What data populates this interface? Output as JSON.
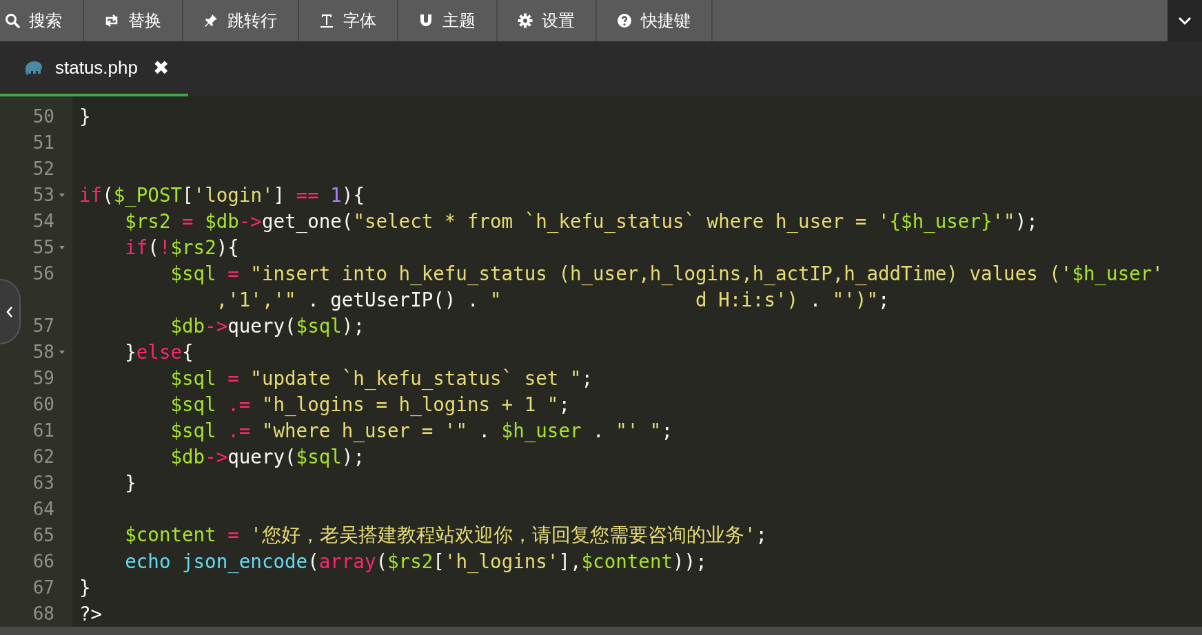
{
  "toolbar": {
    "items": [
      {
        "label": "搜索"
      },
      {
        "label": "替换"
      },
      {
        "label": "跳转行"
      },
      {
        "label": "字体"
      },
      {
        "label": "主题"
      },
      {
        "label": "设置"
      },
      {
        "label": "快捷键"
      }
    ]
  },
  "tabs": [
    {
      "label": "status.php",
      "selected": true,
      "close": "✖"
    }
  ],
  "editor": {
    "lines": [
      {
        "n": "50",
        "foldable": false,
        "tokens": [
          {
            "kind": "plain",
            "text": "}"
          }
        ]
      },
      {
        "n": "51",
        "foldable": false
      },
      {
        "n": "52",
        "foldable": false
      },
      {
        "n": "53",
        "foldable": true,
        "tokens": [
          {
            "kind": "keyword",
            "text": "if"
          },
          {
            "kind": "plain",
            "text": "("
          },
          {
            "kind": "variable",
            "text": "$_POST"
          },
          {
            "kind": "plain",
            "text": "["
          },
          {
            "kind": "string",
            "text": "'login'"
          },
          {
            "kind": "plain",
            "text": "]"
          },
          {
            "kind": "operator",
            "text": " == "
          },
          {
            "kind": "number",
            "text": "1"
          },
          {
            "kind": "plain",
            "text": "){"
          }
        ]
      },
      {
        "n": "54",
        "foldable": false,
        "tokens": [
          {
            "kind": "variable",
            "text": "    $rs2"
          },
          {
            "kind": "operator",
            "text": " = "
          },
          {
            "kind": "variable",
            "text": "$db"
          },
          {
            "kind": "operator",
            "text": "->"
          },
          {
            "kind": "plain",
            "text": "get_one("
          },
          {
            "kind": "string",
            "text": "\"select * from `h_kefu_status` where h_user = '"
          },
          {
            "kind": "variable",
            "text": "{$h_user}"
          },
          {
            "kind": "string",
            "text": "'\""
          },
          {
            "kind": "plain",
            "text": ");"
          }
        ]
      },
      {
        "n": "55",
        "foldable": true,
        "tokens": [
          {
            "kind": "keyword",
            "text": "    if"
          },
          {
            "kind": "plain",
            "text": "("
          },
          {
            "kind": "operator",
            "text": "!"
          },
          {
            "kind": "variable",
            "text": "$rs2"
          },
          {
            "kind": "plain",
            "text": "){"
          }
        ]
      },
      {
        "n": "56",
        "foldable": false,
        "tokens": [
          {
            "kind": "variable",
            "text": "        $sql"
          },
          {
            "kind": "operator",
            "text": " = "
          },
          {
            "kind": "string",
            "text": "\"insert into h_kefu_status (h_user,h_logins,h_actIP,h_addTime) values ('"
          },
          {
            "kind": "variable",
            "text": "$h_user"
          },
          {
            "kind": "string",
            "text": "'"
          }
        ],
        "wrap": [
          {
            "kind": "string",
            "text": "            ,'1','\""
          },
          {
            "kind": "plain",
            "text": " . getUserIP() . "
          },
          {
            "kind": "string",
            "text": "\""
          },
          {
            "kind": "gap"
          },
          {
            "kind": "string",
            "text": "d H:i:s')"
          },
          {
            "kind": "plain",
            "text": " . "
          },
          {
            "kind": "string",
            "text": "\"')\""
          },
          {
            "kind": "plain",
            "text": ";"
          }
        ]
      },
      {
        "n": "57",
        "foldable": false,
        "tokens": [
          {
            "kind": "variable",
            "text": "        $db"
          },
          {
            "kind": "operator",
            "text": "->"
          },
          {
            "kind": "plain",
            "text": "query("
          },
          {
            "kind": "variable",
            "text": "$sql"
          },
          {
            "kind": "plain",
            "text": ");"
          }
        ]
      },
      {
        "n": "58",
        "foldable": true,
        "tokens": [
          {
            "kind": "plain",
            "text": "    }"
          },
          {
            "kind": "keyword",
            "text": "else"
          },
          {
            "kind": "plain",
            "text": "{"
          }
        ]
      },
      {
        "n": "59",
        "foldable": false,
        "tokens": [
          {
            "kind": "variable",
            "text": "        $sql"
          },
          {
            "kind": "operator",
            "text": " = "
          },
          {
            "kind": "string",
            "text": "\"update `h_kefu_status` set \""
          },
          {
            "kind": "plain",
            "text": ";"
          }
        ]
      },
      {
        "n": "60",
        "foldable": false,
        "tokens": [
          {
            "kind": "variable",
            "text": "        $sql"
          },
          {
            "kind": "operator",
            "text": " .= "
          },
          {
            "kind": "string",
            "text": "\"h_logins = h_logins + 1 \""
          },
          {
            "kind": "plain",
            "text": ";"
          }
        ]
      },
      {
        "n": "61",
        "foldable": false,
        "tokens": [
          {
            "kind": "variable",
            "text": "        $sql"
          },
          {
            "kind": "operator",
            "text": " .= "
          },
          {
            "kind": "string",
            "text": "\"where h_user = '\""
          },
          {
            "kind": "plain",
            "text": " . "
          },
          {
            "kind": "variable",
            "text": "$h_user"
          },
          {
            "kind": "plain",
            "text": " . "
          },
          {
            "kind": "string",
            "text": "\"' \""
          },
          {
            "kind": "plain",
            "text": ";"
          }
        ]
      },
      {
        "n": "62",
        "foldable": false,
        "tokens": [
          {
            "kind": "variable",
            "text": "        $db"
          },
          {
            "kind": "operator",
            "text": "->"
          },
          {
            "kind": "plain",
            "text": "query("
          },
          {
            "kind": "variable",
            "text": "$sql"
          },
          {
            "kind": "plain",
            "text": ");"
          }
        ]
      },
      {
        "n": "63",
        "foldable": false,
        "tokens": [
          {
            "kind": "plain",
            "text": "    }"
          }
        ]
      },
      {
        "n": "64",
        "foldable": false
      },
      {
        "n": "65",
        "foldable": false,
        "tokens": [
          {
            "kind": "variable",
            "text": "    $content"
          },
          {
            "kind": "operator",
            "text": " = "
          },
          {
            "kind": "string",
            "text": "'您好，老吴搭建教程站欢迎你，请回复您需要咨询的业务'"
          },
          {
            "kind": "plain",
            "text": ";"
          }
        ]
      },
      {
        "n": "66",
        "foldable": false,
        "tokens": [
          {
            "kind": "function",
            "text": "    echo json_encode"
          },
          {
            "kind": "plain",
            "text": "("
          },
          {
            "kind": "keyword",
            "text": "array"
          },
          {
            "kind": "plain",
            "text": "("
          },
          {
            "kind": "variable",
            "text": "$rs2"
          },
          {
            "kind": "plain",
            "text": "["
          },
          {
            "kind": "string",
            "text": "'h_logins'"
          },
          {
            "kind": "plain",
            "text": "],"
          },
          {
            "kind": "variable",
            "text": "$content"
          },
          {
            "kind": "plain",
            "text": "));"
          }
        ]
      },
      {
        "n": "67",
        "foldable": false,
        "tokens": [
          {
            "kind": "plain",
            "text": "}"
          }
        ]
      },
      {
        "n": "68",
        "foldable": false,
        "tokens": [
          {
            "kind": "plain",
            "text": "?>"
          }
        ]
      }
    ]
  }
}
